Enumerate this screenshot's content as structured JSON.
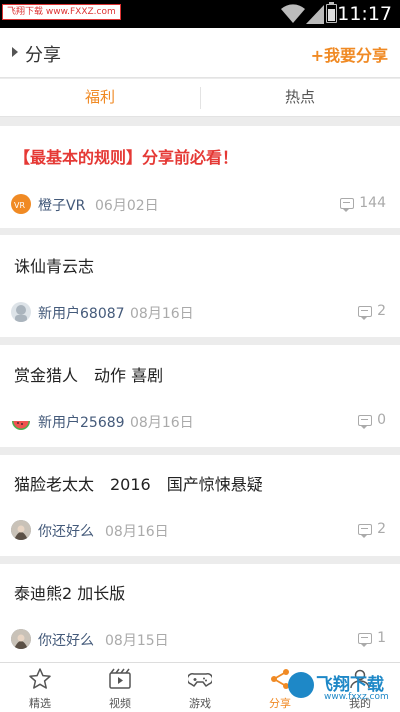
{
  "status_bar": {
    "logo_text": "飞翔下载 www.FXXZ.com",
    "time": "11:17"
  },
  "header": {
    "title": "分享",
    "share_button": "+我要分享"
  },
  "tabs": [
    {
      "label": "福利",
      "active": true
    },
    {
      "label": "热点",
      "active": false
    }
  ],
  "posts": [
    {
      "title": "【最基本的规则】分享前必看！",
      "author": "橙子VR",
      "date": "06月02日",
      "comments": "144"
    },
    {
      "title": "诛仙青云志",
      "author": "新用户68087",
      "date": "08月16日",
      "comments": "2"
    },
    {
      "title": "赏金猎人　动作 喜剧",
      "author": "新用户25689",
      "date": "08月16日",
      "comments": "0"
    },
    {
      "title": "猫脸老太太　2016　国产惊悚悬疑",
      "author": "你还好么",
      "date": "08月16日",
      "comments": "2"
    },
    {
      "title": "泰迪熊2 加长版",
      "author": "你还好么",
      "date": "08月15日",
      "comments": "1"
    }
  ],
  "bottom_nav": [
    {
      "label": "精选",
      "icon": "star-icon"
    },
    {
      "label": "视频",
      "icon": "video-icon"
    },
    {
      "label": "游戏",
      "icon": "gamepad-icon"
    },
    {
      "label": "分享",
      "icon": "share-icon",
      "active": true
    },
    {
      "label": "我的",
      "icon": "user-icon"
    }
  ],
  "watermark": {
    "text": "飞翔下载",
    "url": "www.fxxz.com"
  },
  "colors": {
    "accent": "#f08a24",
    "pinned_title": "#e53935",
    "author": "#445a7a",
    "meta": "#aaaaaa"
  }
}
